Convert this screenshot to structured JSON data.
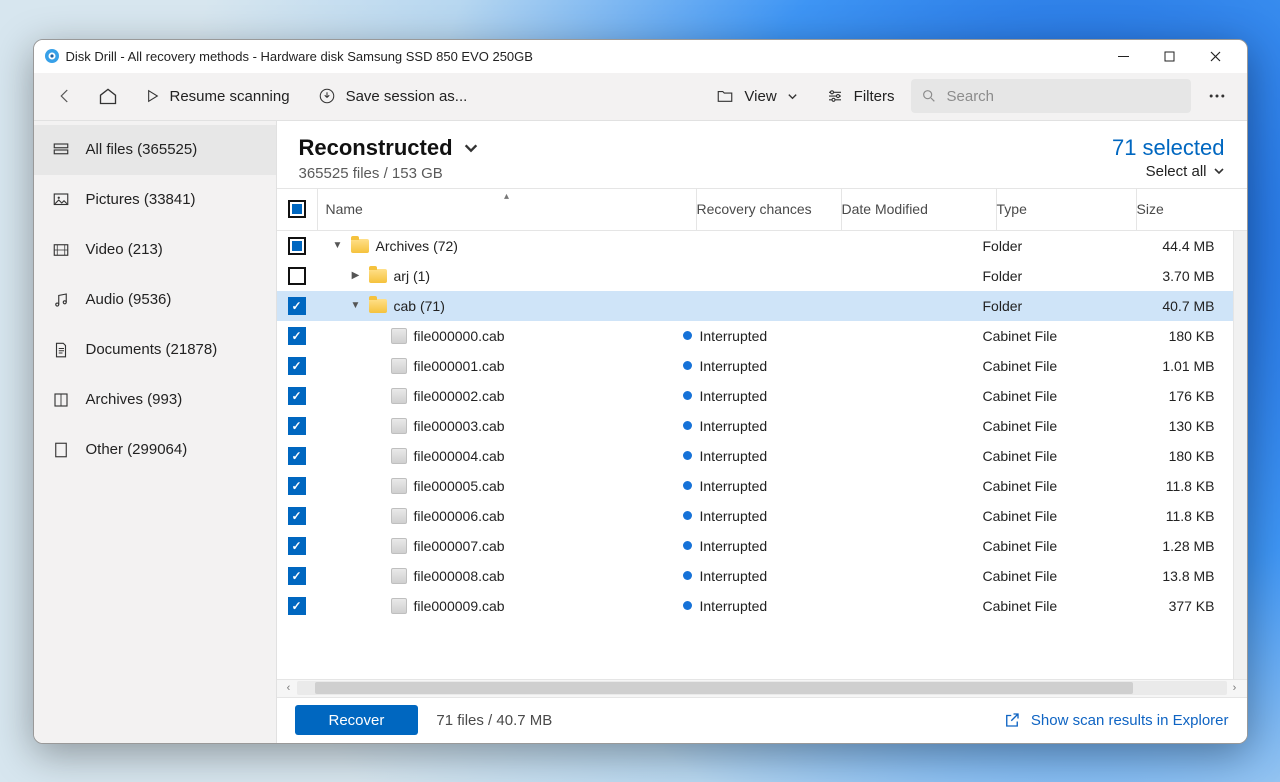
{
  "window": {
    "title": "Disk Drill - All recovery methods - Hardware disk Samsung SSD 850 EVO 250GB"
  },
  "toolbar": {
    "back": "Back",
    "home": "Home",
    "resume": "Resume scanning",
    "save_session": "Save session as...",
    "view": "View",
    "filters": "Filters",
    "search_placeholder": "Search"
  },
  "sidebar": {
    "items": [
      {
        "label": "All files (365525)"
      },
      {
        "label": "Pictures (33841)"
      },
      {
        "label": "Video (213)"
      },
      {
        "label": "Audio (9536)"
      },
      {
        "label": "Documents (21878)"
      },
      {
        "label": "Archives (993)"
      },
      {
        "label": "Other (299064)"
      }
    ]
  },
  "header": {
    "title": "Reconstructed",
    "sub": "365525 files / 153 GB",
    "selected": "71 selected",
    "select_all": "Select all"
  },
  "columns": {
    "name": "Name",
    "recovery": "Recovery chances",
    "date": "Date Modified",
    "type": "Type",
    "size": "Size"
  },
  "rows": [
    {
      "chk": "ind",
      "indent": 0,
      "exp": "down",
      "icon": "folder",
      "name": "Archives (72)",
      "rec": "",
      "type": "Folder",
      "size": "44.4 MB",
      "sel": false
    },
    {
      "chk": "off",
      "indent": 1,
      "exp": "right",
      "icon": "folder",
      "name": "arj (1)",
      "rec": "",
      "type": "Folder",
      "size": "3.70 MB",
      "sel": false
    },
    {
      "chk": "on",
      "indent": 1,
      "exp": "down",
      "icon": "folder",
      "name": "cab (71)",
      "rec": "",
      "type": "Folder",
      "size": "40.7 MB",
      "sel": true
    },
    {
      "chk": "on",
      "indent": 2,
      "exp": "",
      "icon": "file",
      "name": "file000000.cab",
      "rec": "Interrupted",
      "type": "Cabinet File",
      "size": "180 KB",
      "sel": false
    },
    {
      "chk": "on",
      "indent": 2,
      "exp": "",
      "icon": "file",
      "name": "file000001.cab",
      "rec": "Interrupted",
      "type": "Cabinet File",
      "size": "1.01 MB",
      "sel": false
    },
    {
      "chk": "on",
      "indent": 2,
      "exp": "",
      "icon": "file",
      "name": "file000002.cab",
      "rec": "Interrupted",
      "type": "Cabinet File",
      "size": "176 KB",
      "sel": false
    },
    {
      "chk": "on",
      "indent": 2,
      "exp": "",
      "icon": "file",
      "name": "file000003.cab",
      "rec": "Interrupted",
      "type": "Cabinet File",
      "size": "130 KB",
      "sel": false
    },
    {
      "chk": "on",
      "indent": 2,
      "exp": "",
      "icon": "file",
      "name": "file000004.cab",
      "rec": "Interrupted",
      "type": "Cabinet File",
      "size": "180 KB",
      "sel": false
    },
    {
      "chk": "on",
      "indent": 2,
      "exp": "",
      "icon": "file",
      "name": "file000005.cab",
      "rec": "Interrupted",
      "type": "Cabinet File",
      "size": "11.8 KB",
      "sel": false
    },
    {
      "chk": "on",
      "indent": 2,
      "exp": "",
      "icon": "file",
      "name": "file000006.cab",
      "rec": "Interrupted",
      "type": "Cabinet File",
      "size": "11.8 KB",
      "sel": false
    },
    {
      "chk": "on",
      "indent": 2,
      "exp": "",
      "icon": "file",
      "name": "file000007.cab",
      "rec": "Interrupted",
      "type": "Cabinet File",
      "size": "1.28 MB",
      "sel": false
    },
    {
      "chk": "on",
      "indent": 2,
      "exp": "",
      "icon": "file",
      "name": "file000008.cab",
      "rec": "Interrupted",
      "type": "Cabinet File",
      "size": "13.8 MB",
      "sel": false
    },
    {
      "chk": "on",
      "indent": 2,
      "exp": "",
      "icon": "file",
      "name": "file000009.cab",
      "rec": "Interrupted",
      "type": "Cabinet File",
      "size": "377 KB",
      "sel": false
    }
  ],
  "footer": {
    "recover": "Recover",
    "summary": "71 files / 40.7 MB",
    "explorer": "Show scan results in Explorer"
  }
}
